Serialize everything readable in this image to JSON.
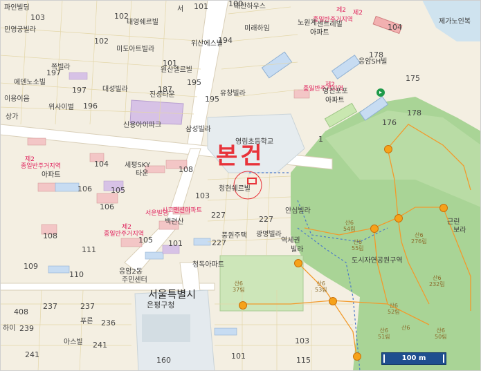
{
  "highlight": {
    "label": "본건",
    "color": "#e8333a"
  },
  "scale_bar": {
    "label": "100 m"
  },
  "landmarks": {
    "court": "서울특별시",
    "court2": "은평구청"
  },
  "labels": [
    "파인빌딩",
    "103",
    "민영궁빌라",
    "102",
    "태영쉐르빌",
    "101",
    "서",
    "100",
    "대한하우스",
    "제2",
    "종일반주거지역",
    "제2",
    "노원계",
    "센트레빌",
    "아파트",
    "미래하임",
    "104",
    "제가노인복",
    "102",
    "미도아트빌라",
    "194",
    "위산에스빌",
    "101",
    "197",
    "쪽빌라",
    "에덴노소빌",
    "197",
    "대성빌라",
    "원산엘르빌",
    "195",
    "187",
    "진성타운",
    "178",
    "응암SH빌",
    "유창빌라",
    "195",
    "제2",
    "종일반주거지역",
    "영진포포",
    "아파트",
    "175",
    "이용이음",
    "196",
    "위사이벌",
    "신용아이파크",
    "178",
    "상가",
    "176",
    "삼성빌라",
    "영림초등학교",
    "1",
    "제2",
    "종일반주거지역",
    "아파트",
    "104",
    "세평SKY",
    "타운",
    "106",
    "105",
    "106",
    "108",
    "103",
    "청현쉐르빌",
    "227",
    "안심빌라",
    "227",
    "서운빌딩",
    "시코맨션아파트",
    "백련산",
    "제2",
    "종일반주거지역",
    "105",
    "101",
    "근린",
    "보라",
    "108",
    "111",
    "109",
    "110",
    "풍원주택",
    "227",
    "광명빌라",
    "역세권",
    "빌라",
    "응암2동",
    "주민센터",
    "청독아파트",
    "도시자연공원구역",
    "408",
    "237",
    "237",
    "하이",
    "239",
    "236",
    "푸른",
    "241",
    "아스빌",
    "241",
    "103",
    "115",
    "160",
    "101"
  ],
  "trail_labels": [
    "산6\n54림",
    "산6\n55림",
    "산6\n276림",
    "산6\n37림",
    "산6\n232림",
    "산6\n52림",
    "산6\n51림",
    "산6\n50림",
    "산6\n53림",
    "산6"
  ]
}
